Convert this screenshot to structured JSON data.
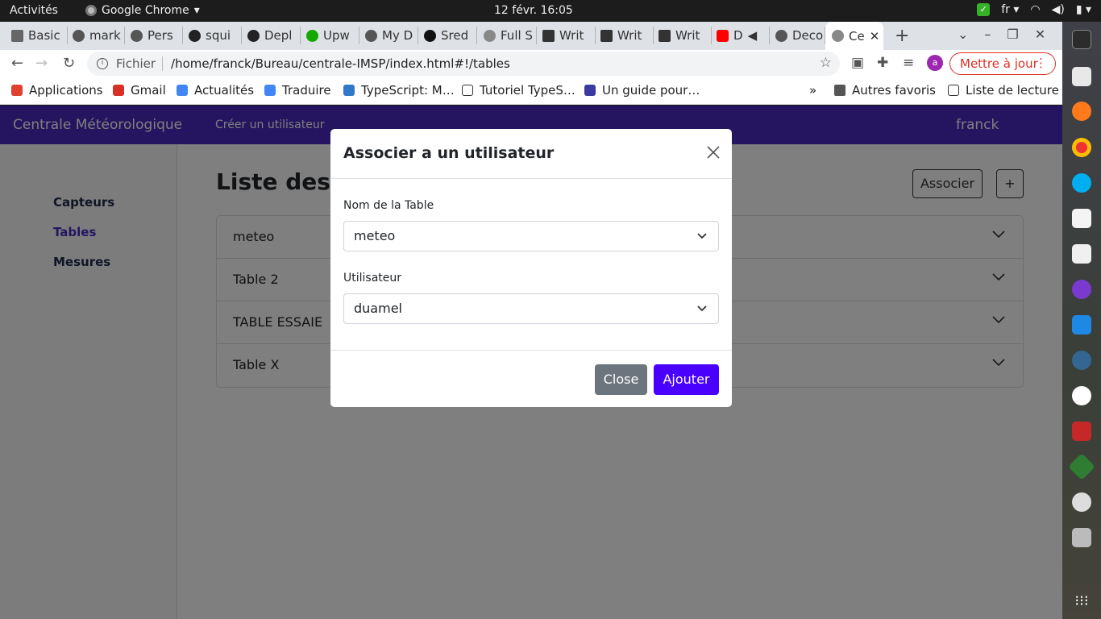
{
  "system": {
    "activities": "Activités",
    "app_name": "Google Chrome",
    "clock": "12 févr.  16:05",
    "lang": "fr"
  },
  "browser": {
    "tabs": [
      {
        "label": "Basic"
      },
      {
        "label": "mark"
      },
      {
        "label": "Pers"
      },
      {
        "label": "squi"
      },
      {
        "label": "Depl"
      },
      {
        "label": "Upw"
      },
      {
        "label": "My D"
      },
      {
        "label": "Sred"
      },
      {
        "label": "Full S"
      },
      {
        "label": "Writ"
      },
      {
        "label": "Writ"
      },
      {
        "label": "Writ"
      },
      {
        "label": "D"
      },
      {
        "label": "Deco"
      },
      {
        "label": "Ce"
      }
    ],
    "url_scheme": "Fichier",
    "url": "/home/franck/Bureau/centrale-IMSP/index.html#!/tables",
    "avatar_letter": "a",
    "update_label": "Mettre à jour",
    "bookmarks": [
      {
        "label": "Applications",
        "color": "#e04030"
      },
      {
        "label": "Gmail",
        "color": "#d93025"
      },
      {
        "label": "Actualités",
        "color": "#4285f4"
      },
      {
        "label": "Traduire",
        "color": "#4285f4"
      },
      {
        "label": "TypeScript: M…",
        "color": "#3178c6"
      },
      {
        "label": "Tutoriel TypeS…",
        "color": "#333333"
      },
      {
        "label": "Un guide pour…",
        "color": "#3a3aa0"
      }
    ],
    "bookmarks_more": "»",
    "other_bookmarks": "Autres favoris",
    "reading_list": "Liste de lecture"
  },
  "app": {
    "brand": "Centrale Météorologique",
    "nav_link": "Créer un utilisateur",
    "user": "franck",
    "sidebar": [
      {
        "label": "Capteurs",
        "active": false
      },
      {
        "label": "Tables",
        "active": true
      },
      {
        "label": "Mesures",
        "active": false
      }
    ],
    "page_title": "Liste des tables",
    "associate_button": "Associer",
    "add_button": "+",
    "tables": [
      {
        "label": "meteo"
      },
      {
        "label": "Table 2"
      },
      {
        "label": "TABLE ESSAIE"
      },
      {
        "label": "Table X"
      }
    ]
  },
  "modal": {
    "title": "Associer a un utilisateur",
    "table_label": "Nom de la Table",
    "table_value": "meteo",
    "user_label": "Utilisateur",
    "user_value": "duamel",
    "close_label": "Close",
    "submit_label": "Ajouter"
  },
  "colors": {
    "navbar": "#4a2ac0",
    "primary_button": "#4a00ff",
    "secondary_button": "#6c757d",
    "update_red": "#d93025"
  }
}
